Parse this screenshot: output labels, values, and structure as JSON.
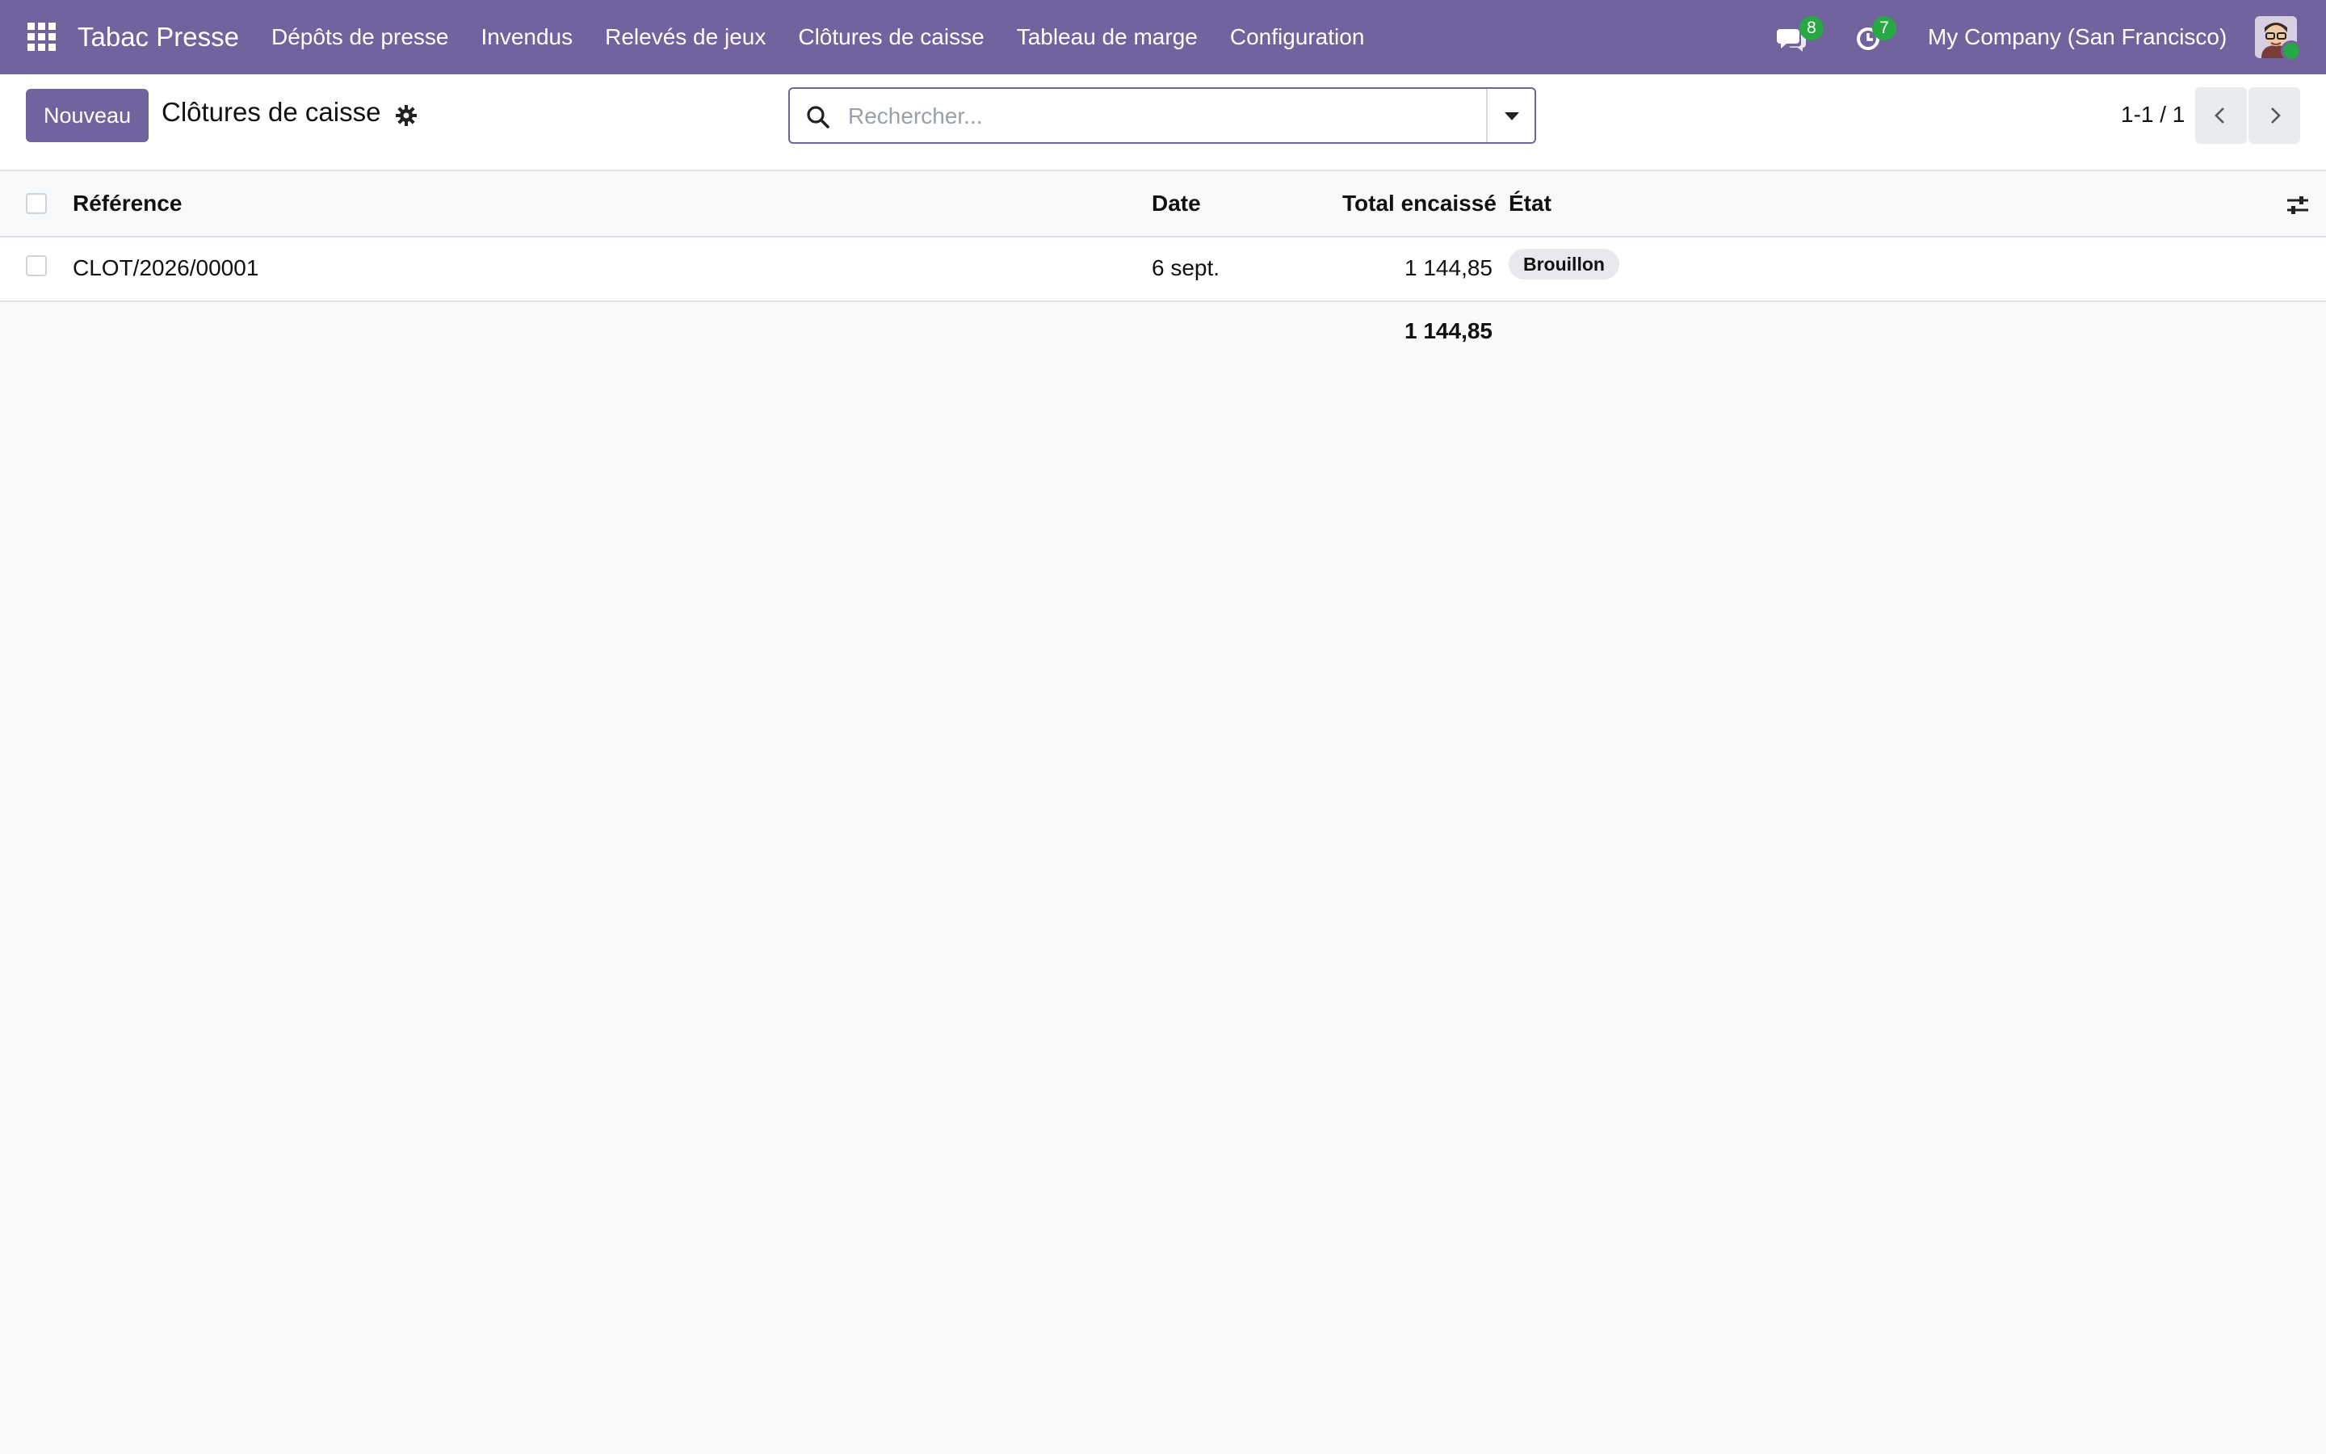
{
  "navbar": {
    "brand": "Tabac Presse",
    "menu": [
      {
        "label": "Dépôts de presse"
      },
      {
        "label": "Invendus"
      },
      {
        "label": "Relevés de jeux"
      },
      {
        "label": "Clôtures de caisse"
      },
      {
        "label": "Tableau de marge"
      },
      {
        "label": "Configuration"
      }
    ],
    "messages_count": "8",
    "activities_count": "7",
    "company": "My Company (San Francisco)",
    "accent_color": "#71639e",
    "badge_color": "#28a745"
  },
  "control_panel": {
    "new_button": "Nouveau",
    "title": "Clôtures de caisse",
    "search_placeholder": "Rechercher...",
    "pager": "1-1 / 1"
  },
  "list": {
    "columns": [
      "Référence",
      "Date",
      "Total encaissé",
      "État"
    ],
    "rows": [
      {
        "reference": "CLOT/2026/00001",
        "date": "6 sept.",
        "total": "1 144,85",
        "state": "Brouillon"
      }
    ],
    "footer_total": "1 144,85"
  }
}
